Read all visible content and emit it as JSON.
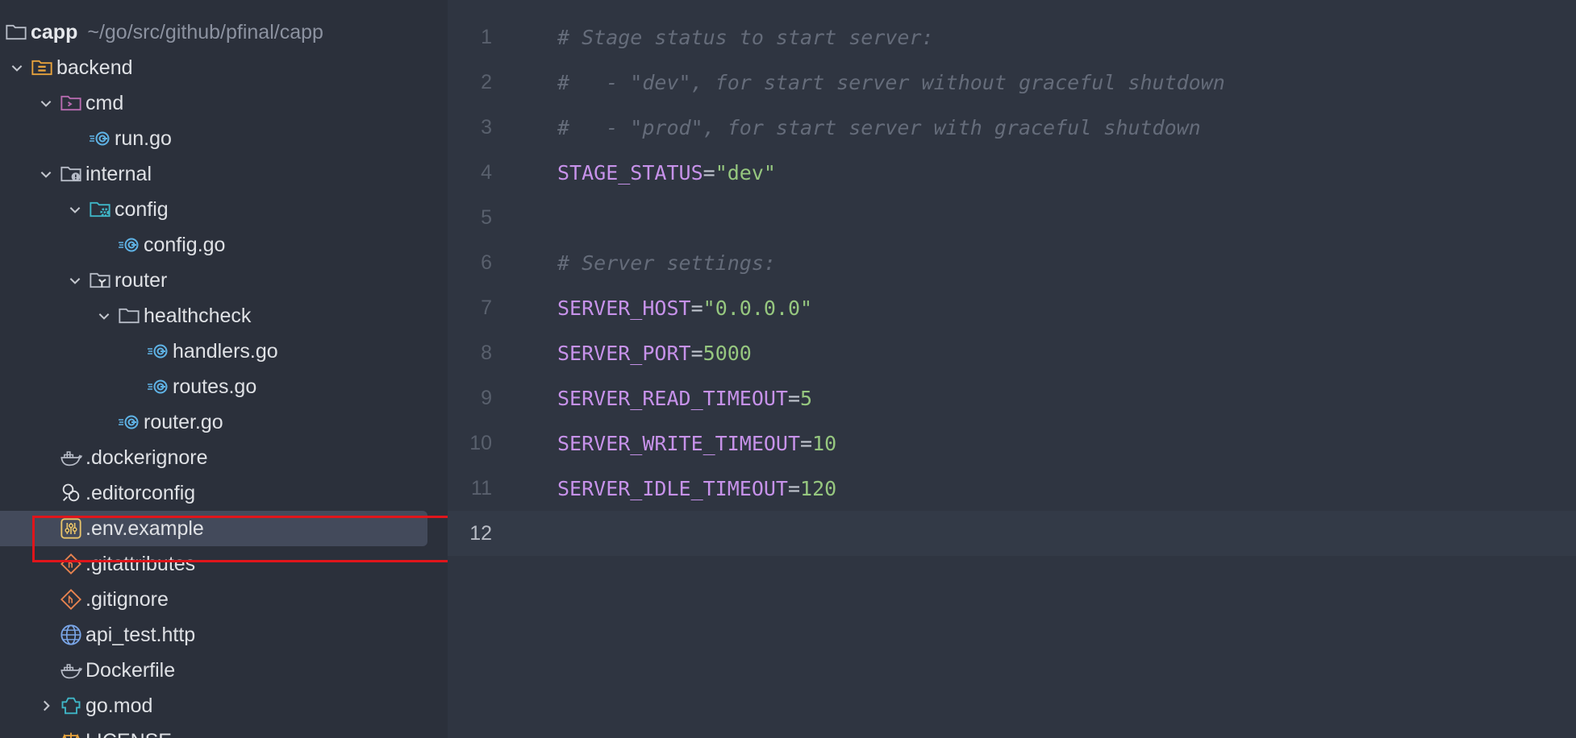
{
  "project": {
    "name": "capp",
    "path": "~/go/src/github/pfinal/capp"
  },
  "tree": [
    {
      "label": "backend",
      "icon": "module-folder-icon",
      "expanded": true
    },
    {
      "label": "cmd",
      "icon": "cmd-folder-icon",
      "expanded": true
    },
    {
      "label": "run.go",
      "icon": "go-file-icon"
    },
    {
      "label": "internal",
      "icon": "internal-folder-icon",
      "expanded": true
    },
    {
      "label": "config",
      "icon": "config-folder-icon",
      "expanded": true
    },
    {
      "label": "config.go",
      "icon": "go-file-icon"
    },
    {
      "label": "router",
      "icon": "router-folder-icon",
      "expanded": true
    },
    {
      "label": "healthcheck",
      "icon": "folder-icon",
      "expanded": true
    },
    {
      "label": "handlers.go",
      "icon": "go-file-icon"
    },
    {
      "label": "routes.go",
      "icon": "go-file-icon"
    },
    {
      "label": "router.go",
      "icon": "go-file-icon"
    },
    {
      "label": ".dockerignore",
      "icon": "docker-icon"
    },
    {
      "label": ".editorconfig",
      "icon": "editorconfig-icon"
    },
    {
      "label": ".env.example",
      "icon": "env-settings-icon",
      "selected": true
    },
    {
      "label": ".gitattributes",
      "icon": "git-icon"
    },
    {
      "label": ".gitignore",
      "icon": "git-icon"
    },
    {
      "label": "api_test.http",
      "icon": "globe-icon"
    },
    {
      "label": "Dockerfile",
      "icon": "docker-icon"
    },
    {
      "label": "go.mod",
      "icon": "go-mod-icon",
      "expanded": false
    },
    {
      "label": "LICENSE",
      "icon": "license-icon"
    }
  ],
  "editor": {
    "current_line": "12",
    "lines": [
      {
        "n": "1",
        "comment": "# Stage status to start server:"
      },
      {
        "n": "2",
        "comment": "#   - \"dev\", for start server without graceful shutdown"
      },
      {
        "n": "3",
        "comment": "#   - \"prod\", for start server with graceful shutdown"
      },
      {
        "n": "4",
        "key": "STAGE_STATUS",
        "eq": "=",
        "value": "\"dev\""
      },
      {
        "n": "5"
      },
      {
        "n": "6",
        "comment": "# Server settings:"
      },
      {
        "n": "7",
        "key": "SERVER_HOST",
        "eq": "=",
        "value": "\"0.0.0.0\""
      },
      {
        "n": "8",
        "key": "SERVER_PORT",
        "eq": "=",
        "value": "5000"
      },
      {
        "n": "9",
        "key": "SERVER_READ_TIMEOUT",
        "eq": "=",
        "value": "5"
      },
      {
        "n": "10",
        "key": "SERVER_WRITE_TIMEOUT",
        "eq": "=",
        "value": "10"
      },
      {
        "n": "11",
        "key": "SERVER_IDLE_TIMEOUT",
        "eq": "=",
        "value": "120"
      },
      {
        "n": "12"
      }
    ]
  },
  "colors": {
    "sidebar_bg": "#2b303b",
    "editor_bg": "#2f3541",
    "selection": "#434a5b",
    "highlight_box": "#e0151b",
    "key": "#c792ea",
    "string": "#96c77f",
    "comment": "#656c7a"
  }
}
